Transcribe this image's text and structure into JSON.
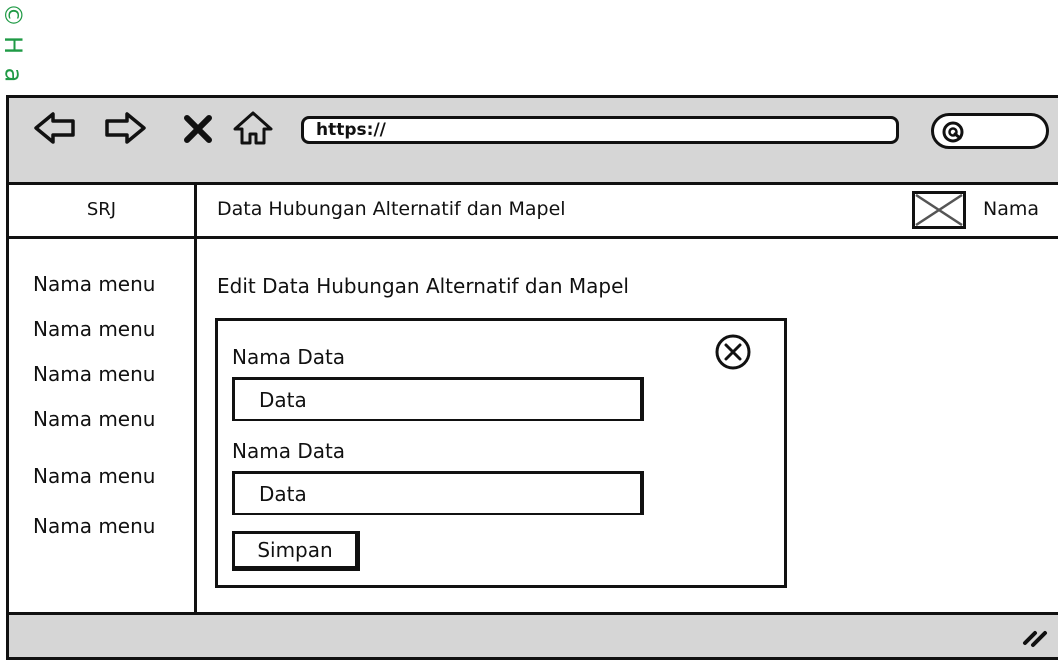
{
  "watermark": {
    "c": "©",
    "h": "H",
    "a": "a"
  },
  "toolbar": {
    "back_icon": "arrow-left-icon",
    "forward_icon": "arrow-right-icon",
    "stop_icon": "close-x-icon",
    "home_icon": "home-icon",
    "url": "https://",
    "search_icon": "search-icon"
  },
  "sidebar": {
    "brand": "SRJ",
    "items": [
      {
        "label": "Nama menu"
      },
      {
        "label": "Nama menu"
      },
      {
        "label": "Nama menu"
      },
      {
        "label": "Nama menu"
      },
      {
        "label": "Nama menu"
      },
      {
        "label": "Nama menu"
      }
    ]
  },
  "header": {
    "title": "Data Hubungan Alternatif dan Mapel",
    "avatar_icon": "image-placeholder-icon",
    "user_name": "Nama"
  },
  "main": {
    "page_title": "Edit Data Hubungan Alternatif dan Mapel",
    "form": {
      "close_icon": "close-circle-icon",
      "fields": [
        {
          "label": "Nama Data",
          "value": "Data"
        },
        {
          "label": "Nama Data",
          "value": "Data"
        }
      ],
      "submit_label": "Simpan"
    }
  },
  "statusbar": {
    "grip_icon": "resize-grip-icon"
  },
  "colors": {
    "chrome": "#d6d6d6",
    "stroke": "#111111",
    "watermark": "#1f9a45"
  }
}
